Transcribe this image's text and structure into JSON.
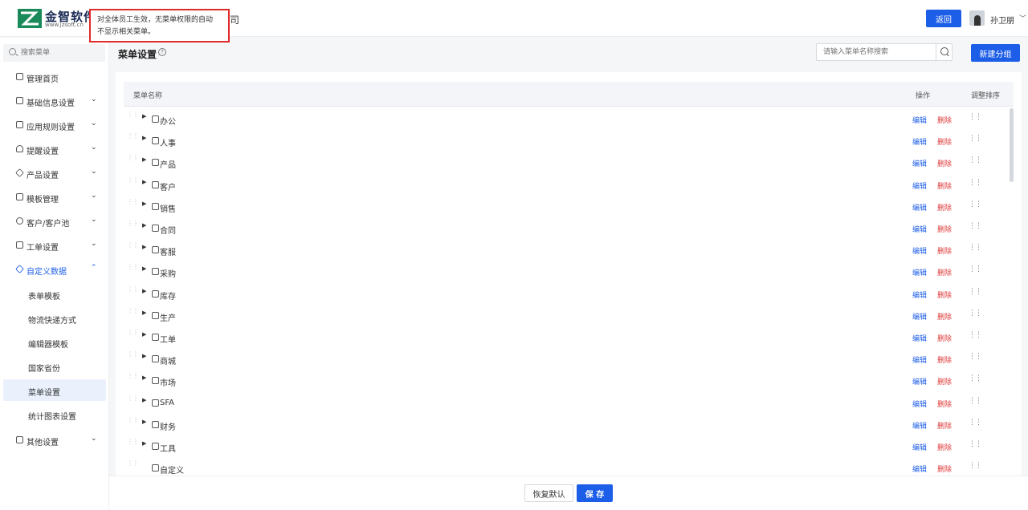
{
  "header": {
    "logo_title": "金智软件",
    "logo_url": "www.jzsoft.cn",
    "company_suffix": "司",
    "tooltip_line1": "对全体员工生效，无菜单权限的自动",
    "tooltip_line2": "不显示相关菜单。",
    "back_label": "返回",
    "user_name": "孙卫朋",
    "user_caret": "﹀"
  },
  "sidebar": {
    "search_placeholder": "搜索菜单",
    "items": [
      {
        "label": "管理首页",
        "icon": "home-icon",
        "caret": ""
      },
      {
        "label": "基础信息设置",
        "icon": "settings-icon",
        "caret": "⌄"
      },
      {
        "label": "应用规则设置",
        "icon": "file-icon",
        "caret": "⌄"
      },
      {
        "label": "提醒设置",
        "icon": "bell-icon",
        "caret": "⌄"
      },
      {
        "label": "产品设置",
        "icon": "box-icon",
        "caret": "⌄"
      },
      {
        "label": "模板管理",
        "icon": "template-icon",
        "caret": "⌄"
      },
      {
        "label": "客户/客户池",
        "icon": "customer-icon",
        "caret": "⌄"
      },
      {
        "label": "工单设置",
        "icon": "ticket-icon",
        "caret": "⌄"
      },
      {
        "label": "自定义数据",
        "icon": "custom-data-icon",
        "caret": "⌃"
      }
    ],
    "subitems": [
      "表单模板",
      "物流快递方式",
      "编辑器模板",
      "国家省份",
      "菜单设置",
      "统计图表设置"
    ],
    "last_item": {
      "label": "其他设置",
      "icon": "grid-icon",
      "caret": "⌄"
    }
  },
  "main": {
    "title": "菜单设置",
    "help_glyph": "?",
    "search_placeholder": "请输入菜单名称搜索",
    "new_group_label": "新建分组",
    "col_name": "菜单名称",
    "col_action": "操作",
    "col_sort": "调整排序",
    "edit_label": "编辑",
    "delete_label": "删除",
    "rows": [
      {
        "label": "办公",
        "icon": "office-icon",
        "expandable": true
      },
      {
        "label": "人事",
        "icon": "people-icon",
        "expandable": true
      },
      {
        "label": "产品",
        "icon": "product-icon",
        "expandable": true
      },
      {
        "label": "客户",
        "icon": "customer-icon",
        "expandable": true
      },
      {
        "label": "销售",
        "icon": "sales-icon",
        "expandable": true
      },
      {
        "label": "合同",
        "icon": "contract-icon",
        "expandable": true
      },
      {
        "label": "客服",
        "icon": "headset-icon",
        "expandable": true
      },
      {
        "label": "采购",
        "icon": "purchase-icon",
        "expandable": true
      },
      {
        "label": "库存",
        "icon": "warehouse-icon",
        "expandable": true
      },
      {
        "label": "生产",
        "icon": "production-icon",
        "expandable": true
      },
      {
        "label": "工单",
        "icon": "ticket-icon",
        "expandable": true
      },
      {
        "label": "商城",
        "icon": "shop-icon",
        "expandable": true
      },
      {
        "label": "市场",
        "icon": "market-icon",
        "expandable": true
      },
      {
        "label": "SFA",
        "icon": "sfa-icon",
        "expandable": true
      },
      {
        "label": "财务",
        "icon": "finance-icon",
        "expandable": true
      },
      {
        "label": "工具",
        "icon": "toolbox-icon",
        "expandable": true
      },
      {
        "label": "自定义",
        "icon": "custom-grid-icon",
        "expandable": false
      }
    ]
  },
  "footer": {
    "reset_label": "恢复默认",
    "save_label": "保 存"
  },
  "colors": {
    "primary": "#1d5ee8",
    "danger": "#e03a3a",
    "tooltip_border": "#e02a2a"
  }
}
